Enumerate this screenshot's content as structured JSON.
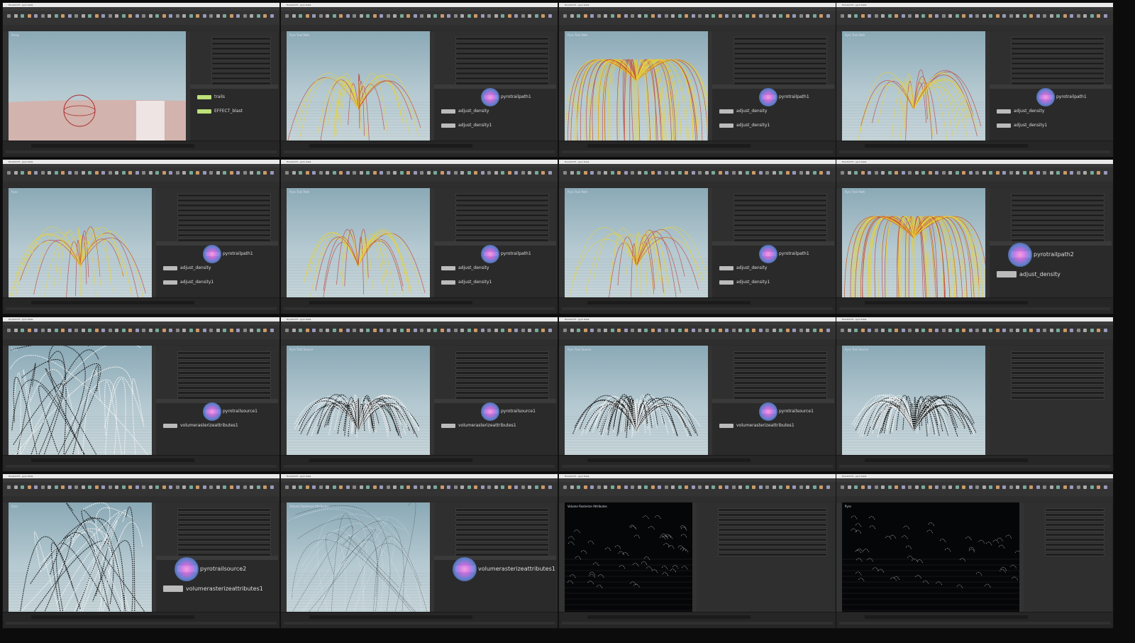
{
  "app_title": "Houdini FX - pyro trails",
  "cells": [
    {
      "viewport": "scene",
      "vp_label": "Persp",
      "nodes": [
        {
          "name": "trails",
          "kind": "fx"
        },
        {
          "name": "EFFECT_blast",
          "kind": "fx"
        }
      ]
    },
    {
      "viewport": "yellow",
      "vp_label": "Pyro Trail Path",
      "nodes": [
        {
          "name": "pyrotrailpath1",
          "kind": "orb"
        },
        {
          "name": "adjust_density",
          "kind": "box"
        },
        {
          "name": "adjust_density1",
          "kind": "box"
        }
      ]
    },
    {
      "viewport": "yellow-dense",
      "vp_label": "Pyro Trail Path",
      "nodes": [
        {
          "name": "pyrotrailpath1",
          "kind": "orb"
        },
        {
          "name": "adjust_density",
          "kind": "box"
        },
        {
          "name": "adjust_density1",
          "kind": "box"
        }
      ]
    },
    {
      "viewport": "yellow",
      "vp_label": "Pyro Trail Path",
      "nodes": [
        {
          "name": "pyrotrailpath1",
          "kind": "orb"
        },
        {
          "name": "adjust_density",
          "kind": "box"
        },
        {
          "name": "adjust_density1",
          "kind": "box"
        }
      ]
    },
    {
      "viewport": "yellow-dots",
      "vp_label": "Pyro",
      "nodes": [
        {
          "name": "pyrotrailpath1",
          "kind": "orb"
        },
        {
          "name": "adjust_density",
          "kind": "box"
        },
        {
          "name": "adjust_density1",
          "kind": "box"
        }
      ]
    },
    {
      "viewport": "yellow-dots",
      "vp_label": "Pyro Trail Path",
      "nodes": [
        {
          "name": "pyrotrailpath1",
          "kind": "orb"
        },
        {
          "name": "adjust_density",
          "kind": "box"
        },
        {
          "name": "adjust_density1",
          "kind": "box"
        }
      ]
    },
    {
      "viewport": "yellow",
      "vp_label": "Pyro Trail Path",
      "nodes": [
        {
          "name": "pyrotrailpath1",
          "kind": "orb"
        },
        {
          "name": "adjust_density",
          "kind": "box"
        },
        {
          "name": "adjust_density1",
          "kind": "box"
        }
      ]
    },
    {
      "viewport": "yellow-dense",
      "vp_label": "Pyro Trail Path",
      "nodes": [
        {
          "name": "pyrotrailpath2",
          "kind": "orb-big"
        },
        {
          "name": "adjust_density",
          "kind": "box-big"
        }
      ]
    },
    {
      "viewport": "bw-close",
      "vp_label": "Pyro",
      "nodes": [
        {
          "name": "pyrotrailsource1",
          "kind": "orb"
        },
        {
          "name": "volumerasterizeattributes1",
          "kind": "box"
        }
      ]
    },
    {
      "viewport": "bw",
      "vp_label": "Pyro Trail Source",
      "nodes": [
        {
          "name": "pyrotrailsource1",
          "kind": "orb"
        },
        {
          "name": "volumerasterizeattributes1",
          "kind": "box"
        }
      ]
    },
    {
      "viewport": "bw",
      "vp_label": "Pyro Trail Source",
      "nodes": [
        {
          "name": "pyrotrailsource1",
          "kind": "orb"
        },
        {
          "name": "volumerasterizeattributes1",
          "kind": "box"
        }
      ]
    },
    {
      "viewport": "bw",
      "vp_label": "Pyro Trail Source",
      "nodes": []
    },
    {
      "viewport": "bw-close",
      "vp_label": "Pyro",
      "nodes": [
        {
          "name": "pyrotrailsource2",
          "kind": "orb-big"
        },
        {
          "name": "volumerasterizeattributes1",
          "kind": "box-big"
        }
      ]
    },
    {
      "viewport": "faint",
      "vp_label": "Volume Rasterize Attributes",
      "nodes": [
        {
          "name": "volumerasterizeattributes1",
          "kind": "orb-big"
        }
      ]
    },
    {
      "viewport": "dark",
      "vp_label": "Volume Rasterize Attributes",
      "nodes": []
    },
    {
      "viewport": "dark-wide",
      "vp_label": "Pyro",
      "nodes": []
    }
  ]
}
